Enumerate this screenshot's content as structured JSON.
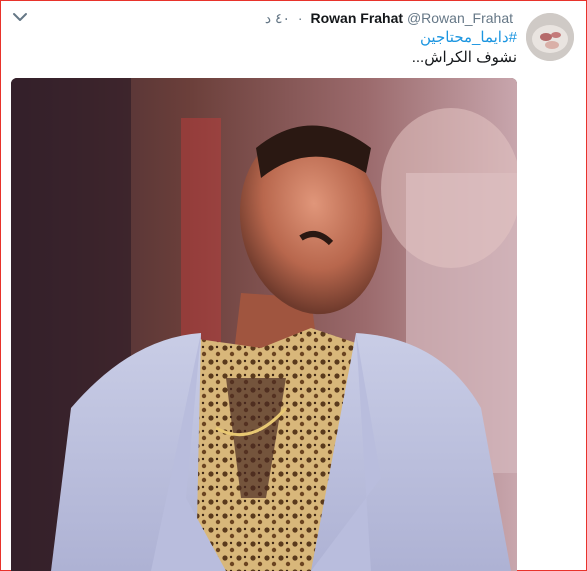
{
  "tweet": {
    "author_name": "Rowan Frahat",
    "handle": "@Rowan_Frahat",
    "separator": "·",
    "time": "٤٠ د",
    "hashtag": "#دايما_محتاجين",
    "text": "نشوف الكراش...",
    "media_alt": "photo"
  },
  "colors": {
    "link": "#1b95e0",
    "name": "#14171a",
    "muted": "#657786",
    "frame": "#e8332b"
  },
  "icons": {
    "more": "chevron-down-icon"
  }
}
